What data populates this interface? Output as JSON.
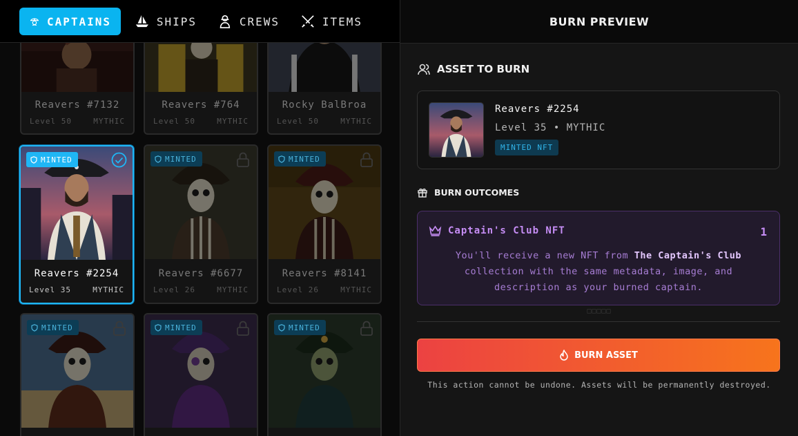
{
  "tabs": [
    {
      "label": "CAPTAINS",
      "icon": "captain-hat-icon",
      "active": true
    },
    {
      "label": "SHIPS",
      "icon": "ship-icon",
      "active": false
    },
    {
      "label": "CREWS",
      "icon": "crew-icon",
      "active": false
    },
    {
      "label": "ITEMS",
      "icon": "crossed-swords-icon",
      "active": false
    }
  ],
  "cards_top": [
    {
      "name": "Reavers #7132",
      "level": "Level 50",
      "rarity": "MYTHIC"
    },
    {
      "name": "Reavers #764",
      "level": "Level 50",
      "rarity": "MYTHIC"
    },
    {
      "name": "Rocky BalBroa",
      "level": "Level 50",
      "rarity": "MYTHIC"
    }
  ],
  "cards_mid": [
    {
      "name": "Reavers #2254",
      "level": "Level 35",
      "rarity": "MYTHIC",
      "badge": "MINTED",
      "selected": true
    },
    {
      "name": "Reavers #6677",
      "level": "Level 26",
      "rarity": "MYTHIC",
      "badge": "MINTED",
      "selected": false
    },
    {
      "name": "Reavers #8141",
      "level": "Level 26",
      "rarity": "MYTHIC",
      "badge": "MINTED",
      "selected": false
    }
  ],
  "cards_bottom": [
    {
      "badge": "MINTED"
    },
    {
      "badge": "MINTED"
    },
    {
      "badge": "MINTED"
    }
  ],
  "preview": {
    "header": "BURN PREVIEW",
    "asset_section": "ASSET TO BURN",
    "asset_name": "Reavers #2254",
    "asset_sub": "Level 35 • MYTHIC",
    "asset_tag": "MINTED NFT",
    "outcomes_section": "BURN OUTCOMES",
    "outcome_title": "Captain's Club NFT",
    "outcome_count": "1",
    "outcome_desc_1": "You'll receive a new NFT from ",
    "outcome_desc_bold": "The Captain's Club",
    "outcome_desc_2": " collection with the same metadata, image, and description as your burned captain.",
    "dots": "□□□□□",
    "burn_label": "BURN ASSET",
    "warning": "This action cannot be undone. Assets will be permanently destroyed."
  },
  "colors": {
    "accent": "#1fb6f5",
    "burn_start": "#ec4242",
    "burn_end": "#f7741c",
    "outcome_purple": "#c68df5"
  }
}
